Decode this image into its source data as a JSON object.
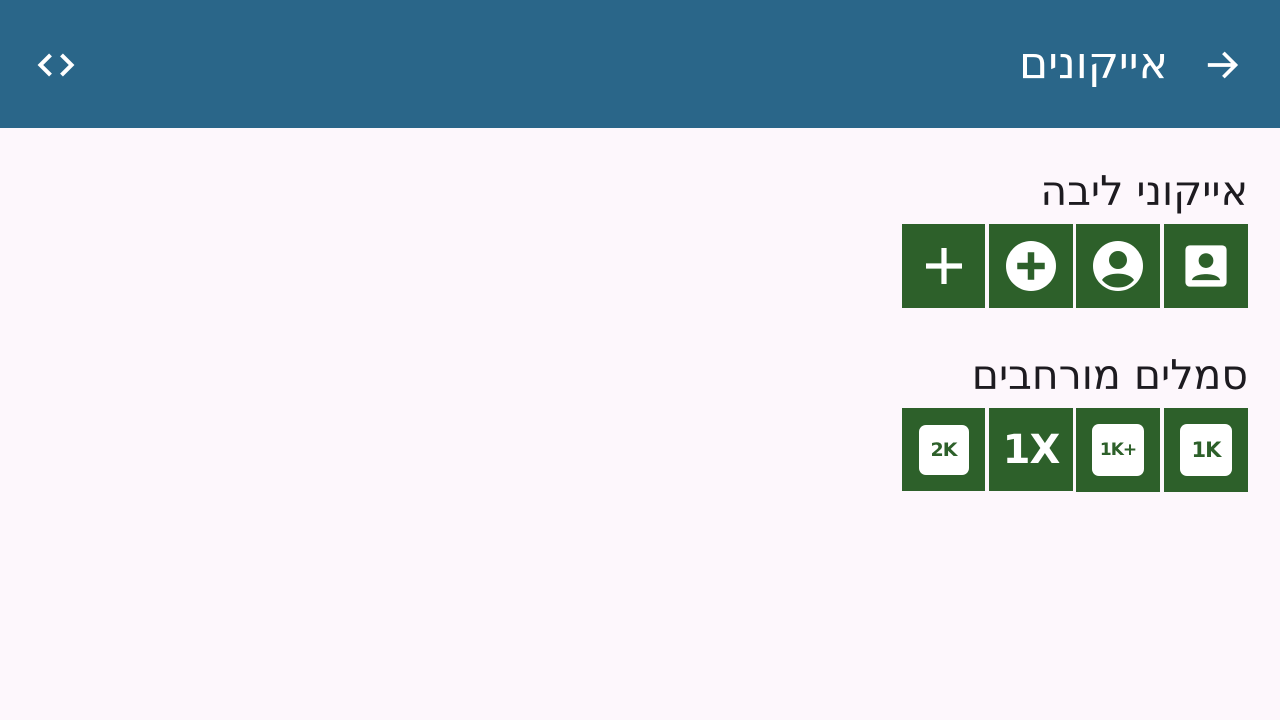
{
  "app_bar": {
    "title": "אייקונים",
    "back_icon": "arrow-forward-icon",
    "code_icon": "code-icon"
  },
  "sections": [
    {
      "title": "אייקוני ליבה",
      "icons": [
        "contact-box-icon",
        "account-circle-icon",
        "add-circle-icon",
        "add-icon"
      ]
    },
    {
      "title": "סמלים מורחבים",
      "icons": [
        {
          "name": "1k-icon",
          "text": "1K"
        },
        {
          "name": "1k-plus-icon",
          "text": "1K+"
        },
        {
          "name": "1x-mobiledata-icon",
          "text": "1X"
        },
        {
          "name": "2k-icon",
          "text": "2K"
        }
      ]
    }
  ],
  "colors": {
    "app_bar": "#2a6689",
    "background": "#fdf7fc",
    "tile": "#2d602a",
    "text": "#1d1b20"
  }
}
